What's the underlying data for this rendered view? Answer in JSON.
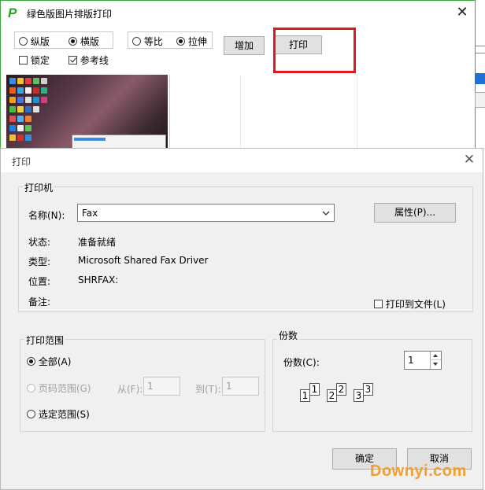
{
  "main_window": {
    "title": "绿色版图片排版打印",
    "logo": "P",
    "close_glyph": "✕",
    "orientation": {
      "portrait": "纵版",
      "landscape": "横版",
      "selected": "landscape"
    },
    "scale": {
      "proportional": "等比",
      "stretch": "拉伸",
      "selected": "stretch"
    },
    "lock_label": "锁定",
    "lock_checked": false,
    "guideline_label": "参考线",
    "guideline_checked": true,
    "add_button": "增加",
    "print_button": "打印"
  },
  "print_dialog": {
    "title": "打印",
    "close_glyph": "✕",
    "printer_group": "打印机",
    "name_label": "名称(N):",
    "printer_name": "Fax",
    "properties_button": "属性(P)...",
    "status_label": "状态:",
    "status_value": "准备就绪",
    "type_label": "类型:",
    "type_value": "Microsoft Shared Fax Driver",
    "where_label": "位置:",
    "where_value": "SHRFAX:",
    "comment_label": "备注:",
    "print_to_file_label": "打印到文件(L)",
    "print_to_file_checked": false,
    "range_group": "打印范围",
    "range_all": "全部(A)",
    "range_pages": "页码范围(G)",
    "range_from_label": "从(F):",
    "range_from_value": "1",
    "range_to_label": "到(T):",
    "range_to_value": "1",
    "range_selection": "选定范围(S)",
    "range_selected": "all",
    "copies_group": "份数",
    "copies_label": "份数(C):",
    "copies_value": "1",
    "collate_pages": [
      "1",
      "1",
      "2",
      "2",
      "3",
      "3"
    ],
    "ok_button": "确定",
    "cancel_button": "取消"
  },
  "watermark": "Downyi.com",
  "colors": {
    "highlight": "#e01818",
    "logo": "#26a526",
    "watermark": "#f0a030",
    "accent_blue": "#1e6fd6"
  }
}
